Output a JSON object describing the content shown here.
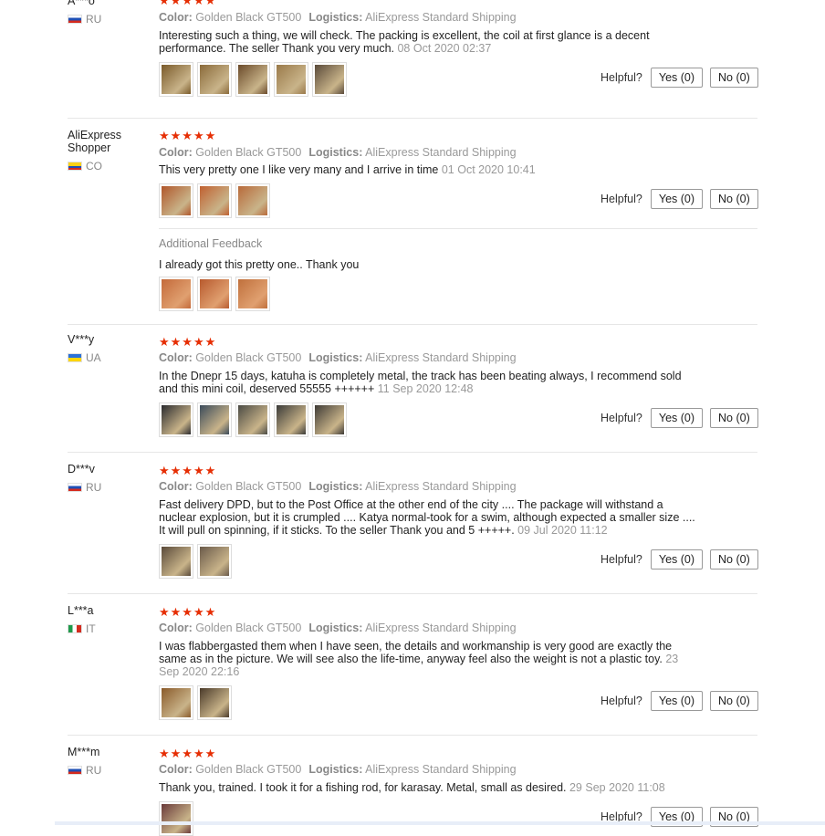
{
  "stars_glyphs": "★★★★★",
  "labels": {
    "color": "Color:",
    "logistics": "Logistics:",
    "helpful": "Helpful?",
    "additional_feedback": "Additional Feedback"
  },
  "colors": {
    "star": "#e62e04",
    "muted_text": "#999999",
    "divider": "#e6e6e6"
  },
  "reviews": [
    {
      "buyer": "A***o",
      "country": "RU",
      "flag": "flag-ru",
      "color_value": "Golden Black GT500",
      "logistics_value": "AliExpress Standard Shipping",
      "text": "Interesting such a thing, we will check. The packing is excellent, the coil at first glance is a decent performance. The seller Thank you very much.",
      "date": "08 Oct 2020 02:37",
      "yes": "Yes (0)",
      "no": "No (0)",
      "photos": [
        "#7a5a2a",
        "#8a6a3a",
        "#6a4a2a",
        "#9a7a4a",
        "#5a4a3a"
      ]
    },
    {
      "buyer": "AliExpress Shopper",
      "country": "CO",
      "flag": "flag-co",
      "color_value": "Golden Black GT500",
      "logistics_value": "AliExpress Standard Shipping",
      "text": "This very pretty one I like very many and I arrive in time",
      "date": "01 Oct 2020 10:41",
      "yes": "Yes (0)",
      "no": "No (0)",
      "photos": [
        "#b0562a",
        "#c06030",
        "#b86a3a"
      ],
      "additional": {
        "text": "I already got this pretty one.. Thank you",
        "photos": [
          "#c46a3a",
          "#b85a2e",
          "#c0703c"
        ]
      }
    },
    {
      "buyer": "V***y",
      "country": "UA",
      "flag": "flag-ua",
      "color_value": "Golden Black GT500",
      "logistics_value": "AliExpress Standard Shipping",
      "text": "In the Dnepr 15 days, katuha is completely metal, the track has been beating always, I recommend sold and this mini coil, deserved 55555 ++++++",
      "date": "11 Sep 2020 12:48",
      "yes": "Yes (0)",
      "no": "No (0)",
      "photos": [
        "#2a2a2e",
        "#3a4a5a",
        "#4a4a44",
        "#3a3a38",
        "#3e3a36"
      ]
    },
    {
      "buyer": "D***v",
      "country": "RU",
      "flag": "flag-ru",
      "color_value": "Golden Black GT500",
      "logistics_value": "AliExpress Standard Shipping",
      "text": "Fast delivery DPD, but to the Post Office at the other end of the city .... The package will withstand a nuclear explosion, but it is crumpled .... Katya normal-took for a swim, although expected a smaller size .... It will pull on spinning, if it sticks. To the seller Thank you and 5 +++++.",
      "date": "09 Jul 2020 11:12",
      "yes": "Yes (0)",
      "no": "No (0)",
      "photos": [
        "#5a4a3a",
        "#6a5a4a"
      ]
    },
    {
      "buyer": "L***a",
      "country": "IT",
      "flag": "flag-it",
      "color_value": "Golden Black GT500",
      "logistics_value": "AliExpress Standard Shipping",
      "text": "I was flabbergasted them when I have seen, the details and workmanship is very good are exactly the same as in the picture. We will see also the life-time, anyway feel also the weight is not a plastic toy.",
      "date": "23 Sep 2020 22:16",
      "yes": "Yes (0)",
      "no": "No (0)",
      "photos": [
        "#8a5a2a",
        "#4a3a2a"
      ]
    },
    {
      "buyer": "M***m",
      "country": "RU",
      "flag": "flag-ru",
      "color_value": "Golden Black GT500",
      "logistics_value": "AliExpress Standard Shipping",
      "text": "Thank you, trained. I took it for a fishing rod, for karasay. Metal, small as desired.",
      "date": "29 Sep 2020 11:08",
      "yes": "Yes (0)",
      "no": "No (0)",
      "photos": [
        "#6a3a3a"
      ]
    }
  ]
}
